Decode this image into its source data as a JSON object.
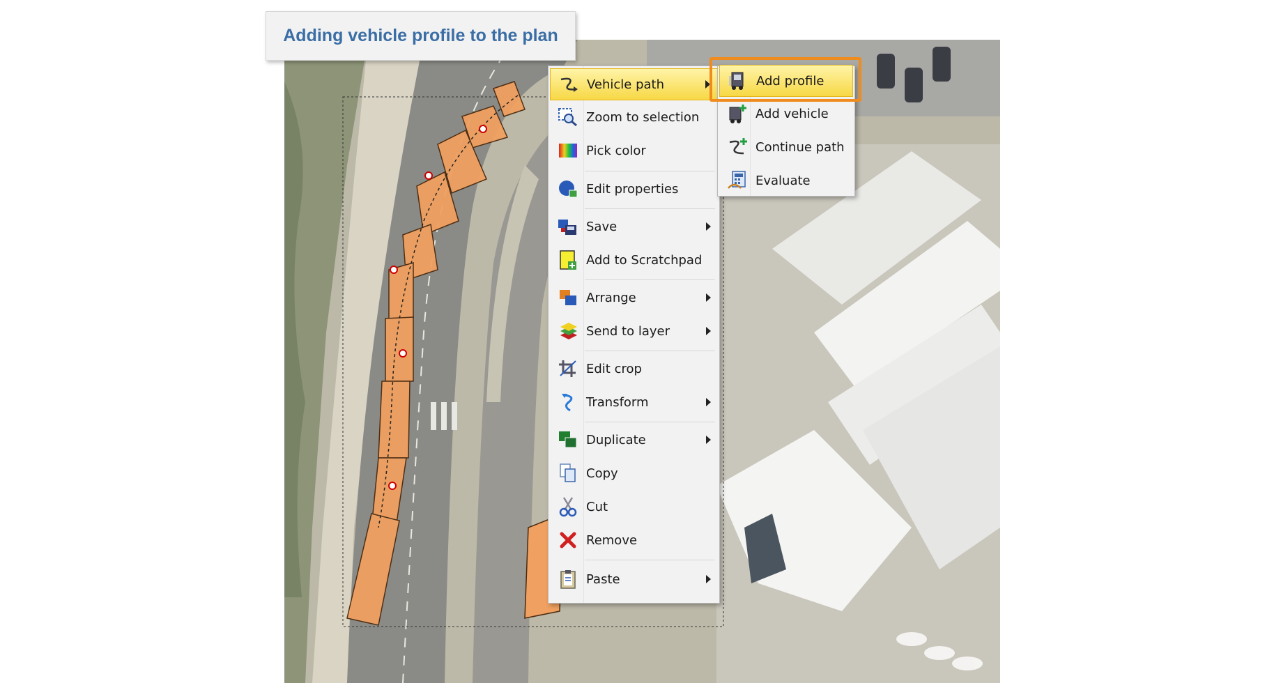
{
  "caption": {
    "title": "Adding vehicle profile to the plan"
  },
  "context_menu": {
    "items": [
      {
        "label": "Vehicle path",
        "icon": "vehicle-path-icon",
        "has_submenu": true,
        "active": true
      },
      {
        "label": "Zoom to selection",
        "icon": "zoom-selection-icon",
        "has_submenu": false
      },
      {
        "label": "Pick color",
        "icon": "color-picker-icon",
        "has_submenu": false
      },
      {
        "label": "Edit properties",
        "icon": "properties-icon",
        "has_submenu": false
      },
      {
        "label": "Save",
        "icon": "save-icon",
        "has_submenu": true
      },
      {
        "label": "Add to Scratchpad",
        "icon": "scratchpad-icon",
        "has_submenu": false
      },
      {
        "label": "Arrange",
        "icon": "arrange-icon",
        "has_submenu": true
      },
      {
        "label": "Send to layer",
        "icon": "layers-icon",
        "has_submenu": true
      },
      {
        "label": "Edit crop",
        "icon": "crop-icon",
        "has_submenu": false
      },
      {
        "label": "Transform",
        "icon": "transform-icon",
        "has_submenu": true
      },
      {
        "label": "Duplicate",
        "icon": "duplicate-icon",
        "has_submenu": true
      },
      {
        "label": "Copy",
        "icon": "copy-icon",
        "has_submenu": false
      },
      {
        "label": "Cut",
        "icon": "scissors-icon",
        "has_submenu": false
      },
      {
        "label": "Remove",
        "icon": "remove-x-icon",
        "has_submenu": false
      },
      {
        "label": "Paste",
        "icon": "clipboard-icon",
        "has_submenu": true
      }
    ]
  },
  "submenu": {
    "items": [
      {
        "label": "Add profile",
        "icon": "add-profile-icon",
        "active": true
      },
      {
        "label": "Add vehicle",
        "icon": "add-vehicle-icon"
      },
      {
        "label": "Continue path",
        "icon": "continue-path-icon"
      },
      {
        "label": "Evaluate",
        "icon": "evaluate-icon"
      }
    ]
  },
  "colors": {
    "highlight_frame": "#f08c1e",
    "caption_text": "#3a6ea5",
    "vehicle_fill": "#f0a060"
  }
}
